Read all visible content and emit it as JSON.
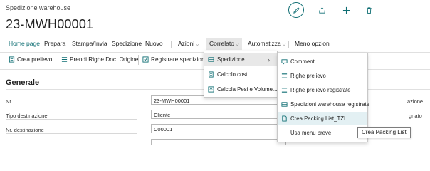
{
  "header": {
    "breadcrumb": "Spedizione warehouse",
    "title": "23-MWH00001",
    "icons": [
      "edit-icon",
      "share-icon",
      "add-icon",
      "delete-icon"
    ]
  },
  "nav": {
    "home": "Home page",
    "prepare": "Prepara",
    "print_send": "Stampa/Invia",
    "shipment": "Spedizione",
    "new": "Nuovo",
    "actions": "Azioni",
    "related": "Correlato",
    "automate": "Automatizza",
    "fewer_options": "Meno opzioni"
  },
  "toolbar": {
    "create_pick": "Crea prelievo...",
    "get_source_lines": "Prendi Righe Doc. Origine",
    "post_shipment": "Registrare spedizione..."
  },
  "general": {
    "section_title": "Generale",
    "fields": [
      {
        "label": "Nr.",
        "value": "23-MWH00001"
      },
      {
        "label": "Tipo destinazione",
        "value": "Cliente"
      },
      {
        "label": "Nr. destinazione",
        "value": "C00001"
      }
    ],
    "right_labels": [
      "azione",
      "gnato"
    ]
  },
  "menu_related": {
    "items": [
      "Spedizione",
      "Calcolo costi",
      "Calcola Pesi e Volume..."
    ]
  },
  "menu_shipment": {
    "items": [
      "Commenti",
      "Righe prelievo",
      "Righe prelievo registrate",
      "Spedizioni warehouse registrate",
      "Crea Packing List_TZI",
      "Usa menu breve"
    ]
  },
  "tooltip": "Crea Packing List",
  "colors": {
    "accent": "#0f6e73",
    "selected": "#e8e8e8",
    "hover": "#e3f0f3"
  }
}
